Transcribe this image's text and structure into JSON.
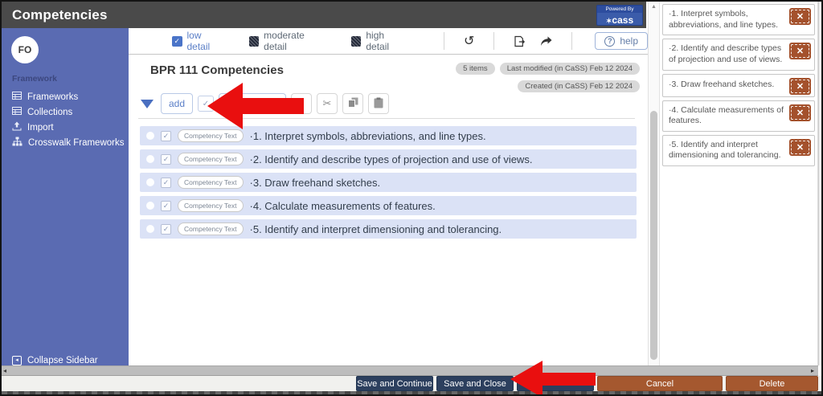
{
  "header": {
    "title": "Competencies",
    "powered_by_label": "Powered By",
    "brand": "cass",
    "brand_icon": "✶"
  },
  "sidebar": {
    "avatar_initials": "FO",
    "section_label": "Framework",
    "items": [
      {
        "label": "Frameworks",
        "icon": "table-icon"
      },
      {
        "label": "Collections",
        "icon": "table-icon"
      },
      {
        "label": "Import",
        "icon": "upload-icon"
      },
      {
        "label": "Crosswalk Frameworks",
        "icon": "sitemap-icon"
      }
    ],
    "collapse_label": "Collapse Sidebar"
  },
  "detail_toolbar": {
    "options": [
      {
        "label": "low detail",
        "checked": true
      },
      {
        "label": "moderate detail",
        "checked": false
      },
      {
        "label": "high detail",
        "checked": false
      }
    ],
    "help_label": "help"
  },
  "framework": {
    "title": "BPR 111 Competencies",
    "badges": [
      "5 items",
      "Last modified (in CaSS) Feb 12 2024",
      "Created (in CaSS) Feb 12 2024"
    ],
    "add_button_label": "add"
  },
  "competencies": [
    {
      "type_label": "Competency Text",
      "text": "·1. Interpret symbols, abbreviations, and line types."
    },
    {
      "type_label": "Competency Text",
      "text": "·2. Identify and describe types of projection and use of views."
    },
    {
      "type_label": "Competency Text",
      "text": "·3. Draw freehand sketches."
    },
    {
      "type_label": "Competency Text",
      "text": "·4. Calculate measurements of features."
    },
    {
      "type_label": "Competency Text",
      "text": "·5. Identify and interpret dimensioning and tolerancing."
    }
  ],
  "right_panel": {
    "items": [
      "·1. Interpret symbols, abbreviations, and line types.",
      "·2. Identify and describe types of projection and use of views.",
      "·3. Draw freehand sketches.",
      "·4. Calculate measurements of features.",
      "·5. Identify and interpret dimensioning and tolerancing."
    ]
  },
  "footer": {
    "save_continue": "Save and Continue",
    "save_close": "Save and Close",
    "cancel": "Cancel",
    "delete": "Delete"
  },
  "icons": {
    "check": "✓",
    "undo": "↺",
    "scissors": "✂",
    "gear": "⚙",
    "help_q": "?",
    "close": "✕",
    "up": "▲",
    "left": "◂",
    "right": "▸",
    "collapse": "◂"
  },
  "colors": {
    "header_gray": "#4a4a4a",
    "sidebar_blue": "#5a6bb2",
    "accent_blue": "#5b7fc7",
    "row_lavender": "#dbe2f6",
    "navy_button": "#2c3f5e",
    "brown_button": "#a5582f",
    "remove_button": "#a4512c",
    "arrow_red": "#e90f0f"
  }
}
